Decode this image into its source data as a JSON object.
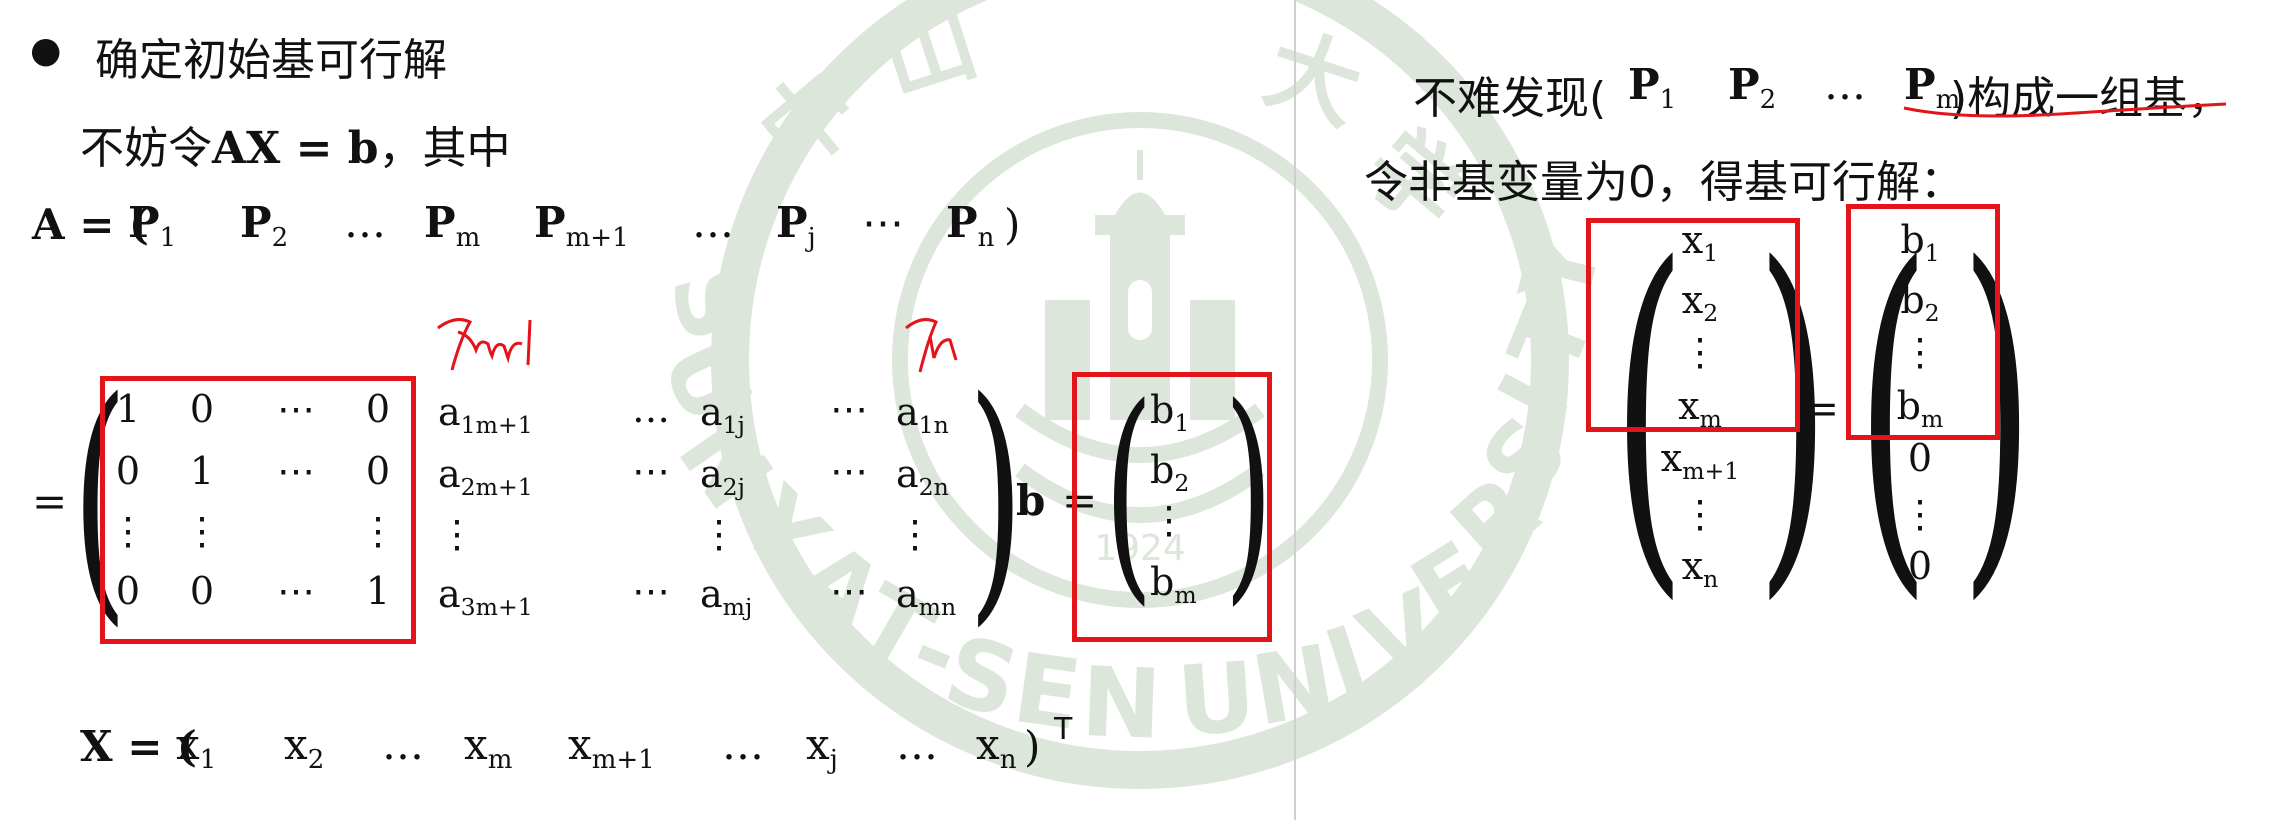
{
  "watermark": {
    "university_name": "SUN YAT-SEN UNIVERSITY",
    "chinese_chars": "中山大学",
    "year": "1924",
    "color": "#dde6da"
  },
  "colors": {
    "box": "#e3151b",
    "handwriting": "#e3151b",
    "divider": "#cfcfcf",
    "text": "#111111"
  },
  "left": {
    "bullet": "●",
    "heading": "确定初始基可行解",
    "intro_prefix": "不妨令",
    "intro_eq": "AX = b",
    "intro_suffix": "，其中",
    "A_row": {
      "lhs": "A = (",
      "items": [
        {
          "base": "P",
          "sub": "1"
        },
        {
          "base": "P",
          "sub": "2"
        },
        {
          "base": "…",
          "sub": ""
        },
        {
          "base": "P",
          "sub": "m"
        },
        {
          "base": "P",
          "sub": "m+1"
        },
        {
          "base": "…",
          "sub": ""
        },
        {
          "base": "P",
          "sub": "j"
        },
        {
          "base": "⋯",
          "sub": ""
        },
        {
          "base": "P",
          "sub": "n"
        }
      ],
      "close": ")"
    },
    "eq_sign": "=",
    "handwriting": [
      "Pm+1",
      "Pn"
    ],
    "identity": {
      "rows": [
        [
          "1",
          "0",
          "⋯",
          "0"
        ],
        [
          "0",
          "1",
          "⋯",
          "0"
        ],
        [
          "⋮",
          "⋮",
          "",
          "⋮"
        ],
        [
          "0",
          "0",
          "⋯",
          "1"
        ]
      ]
    },
    "a_cols": {
      "col1": [
        {
          "b": "a",
          "s": "1m+1"
        },
        {
          "b": "a",
          "s": "2m+1"
        },
        {
          "b": "⋮",
          "s": ""
        },
        {
          "b": "a",
          "s": "3m+1"
        }
      ],
      "col2": [
        "…",
        "⋯",
        "",
        "⋯"
      ],
      "col3": [
        {
          "b": "a",
          "s": "1j"
        },
        {
          "b": "a",
          "s": "2j"
        },
        {
          "b": "⋮",
          "s": ""
        },
        {
          "b": "a",
          "s": "mj"
        }
      ],
      "col4": [
        "⋯",
        "⋯",
        "",
        "⋯"
      ],
      "col5": [
        {
          "b": "a",
          "s": "1n"
        },
        {
          "b": "a",
          "s": "2n"
        },
        {
          "b": "⋮",
          "s": ""
        },
        {
          "b": "a",
          "s": "mn"
        }
      ]
    },
    "b_label": "b",
    "b_eq": "=",
    "b_vector": [
      {
        "b": "b",
        "s": "1"
      },
      {
        "b": "b",
        "s": "2"
      },
      {
        "b": "⋮",
        "s": ""
      },
      {
        "b": "b",
        "s": "m"
      }
    ],
    "trailing_comma": ",",
    "X_row": {
      "lhs": "X = (",
      "items": [
        {
          "base": "x",
          "sub": "1"
        },
        {
          "base": "x",
          "sub": "2"
        },
        {
          "base": "…",
          "sub": ""
        },
        {
          "base": "x",
          "sub": "m"
        },
        {
          "base": "x",
          "sub": "m+1"
        },
        {
          "base": "…",
          "sub": ""
        },
        {
          "base": "x",
          "sub": "j"
        },
        {
          "base": "…",
          "sub": ""
        },
        {
          "base": "x",
          "sub": "n"
        }
      ],
      "close": ")",
      "sup": "T"
    }
  },
  "right": {
    "line1_prefix": "不难发现(",
    "line1_items": [
      {
        "base": "P",
        "sub": "1"
      },
      {
        "base": "P",
        "sub": "2"
      },
      {
        "base": "…",
        "sub": ""
      },
      {
        "base": "P",
        "sub": "m"
      }
    ],
    "line1_suffix": ")构成一组基，",
    "line2": "令非基变量为0，得基可行解：",
    "x_vector": [
      {
        "b": "x",
        "s": "1"
      },
      {
        "b": "x",
        "s": "2"
      },
      {
        "b": "⋮",
        "s": ""
      },
      {
        "b": "x",
        "s": "m"
      },
      {
        "b": "x",
        "s": "m+1"
      },
      {
        "b": "⋮",
        "s": ""
      },
      {
        "b": "x",
        "s": "n"
      }
    ],
    "eq": "=",
    "b_vector": [
      {
        "b": "b",
        "s": "1"
      },
      {
        "b": "b",
        "s": "2"
      },
      {
        "b": "⋮",
        "s": ""
      },
      {
        "b": "b",
        "s": "m"
      },
      {
        "b": "0",
        "s": ""
      },
      {
        "b": "⋮",
        "s": ""
      },
      {
        "b": "0",
        "s": ""
      }
    ]
  }
}
